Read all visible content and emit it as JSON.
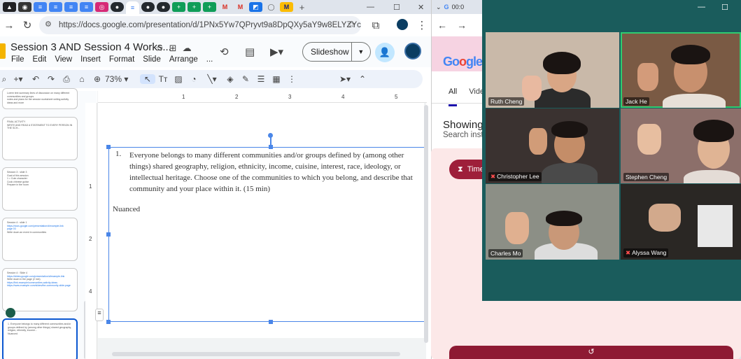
{
  "browser": {
    "url": "https://docs.google.com/presentation/d/1PNx5Yw7QPryvt9a8DpQXy5aY9w8ELYZYcoWuGl...",
    "tab_icons": [
      "app-tab",
      "gmail-tab",
      "docs-tab",
      "docs-tab",
      "docs-tab",
      "docs-tab",
      "instagram-tab",
      "github-tab",
      "docs-tab",
      "github-tab",
      "github-tab",
      "sheets-tab",
      "sheets-tab",
      "sheets-tab",
      "gmail-tab",
      "gmail-tab",
      "kb-tab",
      "circle-tab",
      "m-tab"
    ],
    "new_tab": "+"
  },
  "slides": {
    "doc_title": "Session 3 AND Session 4 Works...",
    "menus": [
      "File",
      "Edit",
      "View",
      "Insert",
      "Format",
      "Slide",
      "Arrange",
      "..."
    ],
    "slideshow_label": "Slideshow",
    "zoom": "73%",
    "thumbs": [
      {
        "lines": [
          "Lorem text summary lines of discussion on many different communities and groups",
          "notes and plans for the session worksheet writing activity ideas and more"
        ]
      },
      {
        "lines": [
          "FINAL ACTIVITY",
          "WRITE AND READ A STATEMENT TO EVERY PERSON IN THE SCH..."
        ]
      },
      {
        "lines": [
          "Session 3 : slide 3",
          "Goal of this session",
          "1 = Cute character",
          "",
          "Cook chinese guitar",
          "",
          "Prepare in the room"
        ]
      },
      {
        "lines": [
          "Session 4 : slide 1",
          "https://docs.google.com/presentation/d/example-link",
          "page 03",
          "",
          "Write down an event in communities"
        ]
      },
      {
        "lines": [
          "Session 4 : Slide 4",
          "https://slides.google.com/presentation/d/example-link",
          "Write down in the page (2 min)",
          "",
          "https://link.example/communities-activity-ideas",
          "https://www.example.com/slides/the-community-slide-page"
        ]
      },
      {
        "lines": [
          "1. Everyone belongs to many different communities and/or groups defined by (among other things) shared geography, religion, ethnicity, income...",
          "",
          "Nuanced"
        ]
      }
    ],
    "item_number": "1.",
    "paragraph": "Everyone belongs to many different communities and/or groups defined by (among other things) shared geography, religion, ethnicity, income, cuisine, interest, race, ideology, or intellectual heritage. Choose one of the communities to which you belong, and describe that community and your place within it. (15 min)",
    "answer": "Nuanced"
  },
  "google": {
    "tab_title": "00:0",
    "tab_all": "All",
    "tab_videos": "Vide",
    "showing": "Showing r",
    "search_instead": "Search inste",
    "timer_label": "Time",
    "reset_icon": "↺"
  },
  "zoom": {
    "participants": [
      {
        "name": "Ruth Cheng",
        "muted": false,
        "active": false
      },
      {
        "name": "Jack He",
        "muted": false,
        "active": true
      },
      {
        "name": "Christopher Lee",
        "muted": true,
        "active": false
      },
      {
        "name": "Stephen Cheng",
        "muted": false,
        "active": false
      },
      {
        "name": "Charles Mo",
        "muted": false,
        "active": false
      },
      {
        "name": "Alyssa Wang",
        "muted": true,
        "active": false
      }
    ]
  }
}
